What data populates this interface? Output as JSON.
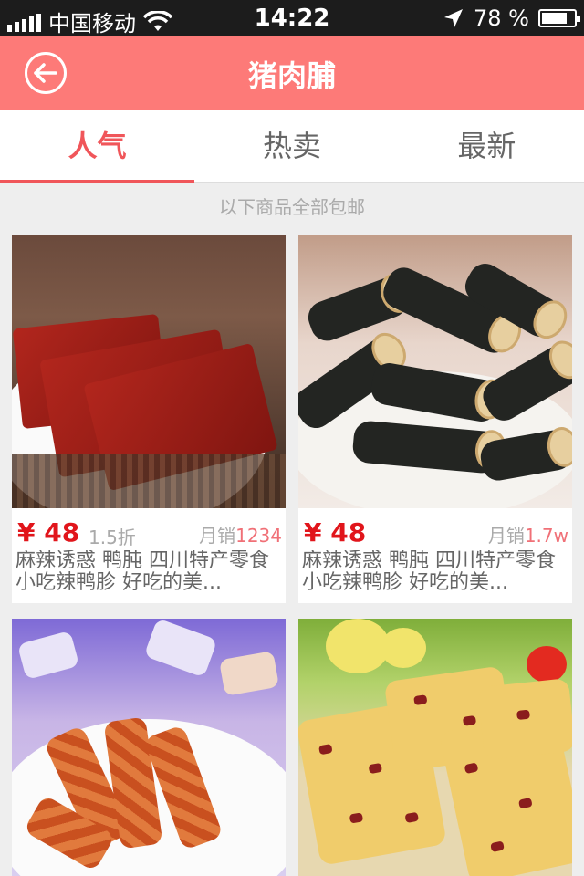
{
  "status_bar": {
    "carrier": "中国移动",
    "time": "14:22",
    "battery_percent": "78 %",
    "battery_level": 0.78
  },
  "nav": {
    "title": "猪肉脯",
    "back_icon": "back-arrow-circle-icon"
  },
  "tabs": [
    {
      "label": "人气",
      "active": true
    },
    {
      "label": "热卖",
      "active": false
    },
    {
      "label": "最新",
      "active": false
    }
  ],
  "notice": "以下商品全部包邮",
  "products": [
    {
      "price": "¥ 48",
      "discount": "1.5折",
      "sales_label": "月销",
      "sales_value": "1234",
      "desc": "麻辣诱惑 鸭肫 四川特产零食小吃辣鸭胗 好吃的美..."
    },
    {
      "price": "¥ 48",
      "discount": "",
      "sales_label": "月销",
      "sales_value": "1.7w",
      "desc": "麻辣诱惑 鸭肫 四川特产零食小吃辣鸭胗 好吃的美..."
    },
    {
      "price": "",
      "discount": "",
      "sales_label": "",
      "sales_value": "",
      "desc": ""
    },
    {
      "price": "",
      "discount": "",
      "sales_label": "",
      "sales_value": "",
      "desc": ""
    }
  ],
  "colors": {
    "nav_bg": "#fd7a78",
    "accent": "#f0565a",
    "price": "#e1151b"
  }
}
